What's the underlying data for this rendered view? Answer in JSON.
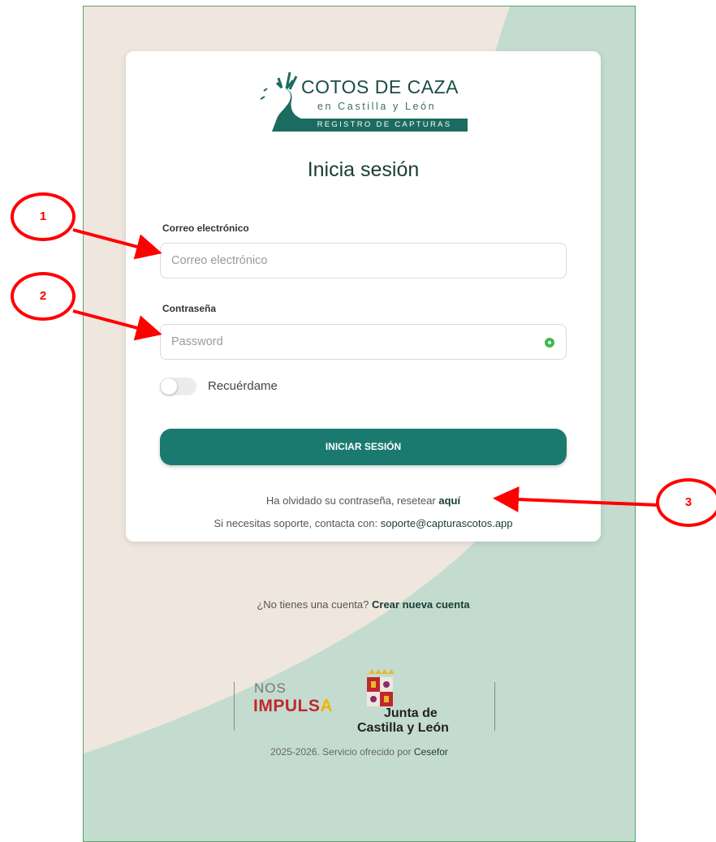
{
  "logo": {
    "title": "COTOS DE CAZA",
    "subtitle": "en Castilla y León",
    "band": "REGISTRO DE CAPTURAS"
  },
  "form": {
    "heading": "Inicia sesión",
    "email_label": "Correo electrónico",
    "email_placeholder": "Correo electrónico",
    "password_label": "Contraseña",
    "password_placeholder": "Password",
    "remember_label": "Recuérdame",
    "submit_label": "INICIAR SESIÓN",
    "forgot_text": "Ha olvidado su contraseña, resetear",
    "forgot_link": "aquí",
    "support_text": "Si necesitas soporte, contacta con:",
    "support_email": "soporte@capturascotos.app",
    "remember_checked": false
  },
  "signup": {
    "text": "¿No tienes una cuenta?",
    "link": "Crear nueva cuenta"
  },
  "sponsors": {
    "nos": "NOS",
    "impulsa_main": "IMPULS",
    "impulsa_accent": "A",
    "junta_line1": "Junta de",
    "junta_line2": "Castilla y León"
  },
  "footer": {
    "text": "2025-2026. Servicio ofrecido por",
    "link": "Cesefor"
  },
  "annotations": {
    "marker1": "1",
    "marker2": "2",
    "marker3": "3"
  },
  "colors": {
    "accent": "#1b7a70",
    "background_beige": "#efe7de",
    "background_green": "#c4dccf",
    "annotation_red": "#ff0000"
  }
}
